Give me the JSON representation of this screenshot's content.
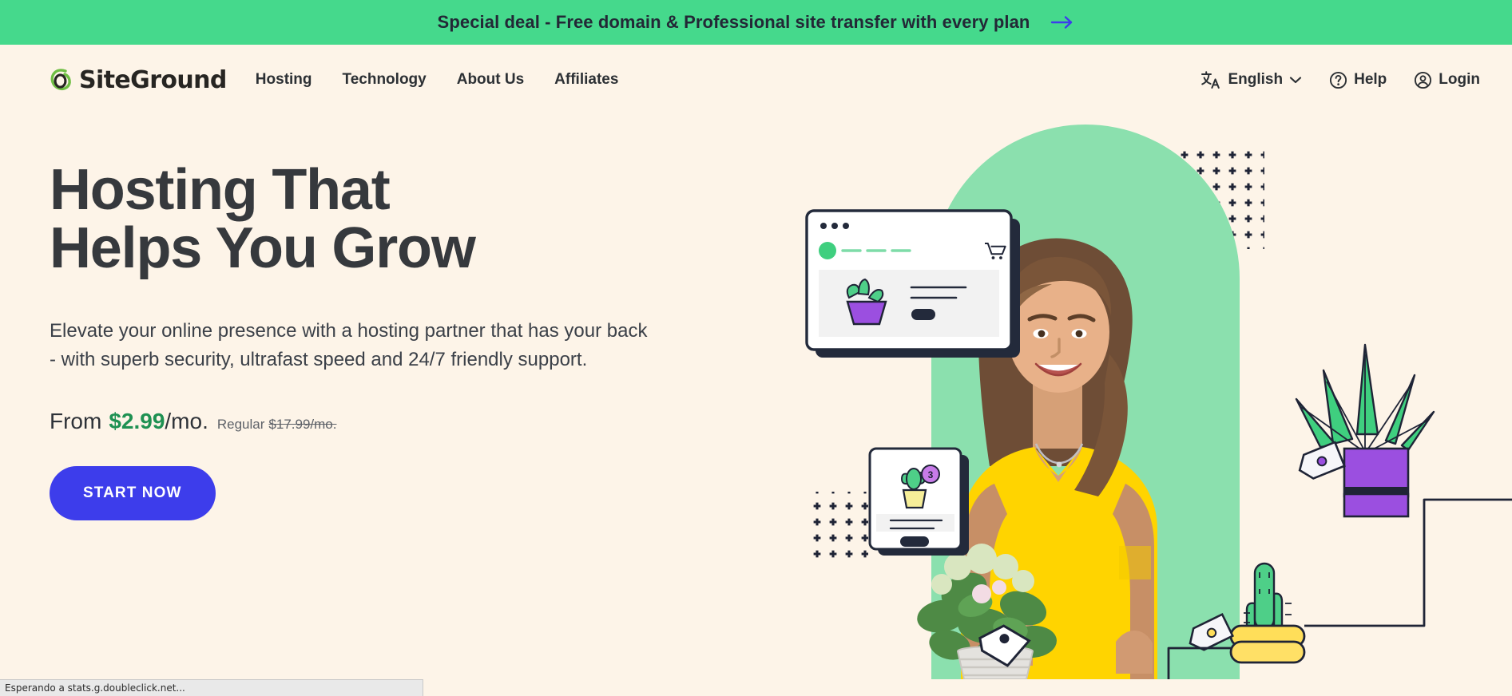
{
  "promo": {
    "text": "Special deal - Free domain & Professional site transfer with every plan",
    "arrow_icon": "arrow-right-icon",
    "bg_color": "#45D98C",
    "text_color": "#232836",
    "arrow_color": "#3D3DEB"
  },
  "header": {
    "brand": {
      "name": "SiteGround",
      "mark_icon": "siteground-swirl-logo-icon",
      "mark_color": "#6FBE44"
    },
    "nav": [
      {
        "label": "Hosting"
      },
      {
        "label": "Technology"
      },
      {
        "label": "About Us"
      },
      {
        "label": "Affiliates"
      }
    ],
    "right": {
      "language": {
        "label": "English",
        "icon": "translate-icon",
        "chevron": "chevron-down-icon"
      },
      "help": {
        "label": "Help",
        "icon": "question-circle-icon"
      },
      "login": {
        "label": "Login",
        "icon": "user-circle-icon"
      }
    }
  },
  "hero": {
    "title": "Hosting That\nHelps You Grow",
    "subtitle": "Elevate your online presence with a hosting partner that has your back\n- with superb security, ultrafast speed and 24/7 friendly support.",
    "price": {
      "from_label": "From",
      "amount": "$2.99",
      "per": "/mo.",
      "regular_label": "Regular",
      "regular_price": "$17.99/mo.",
      "amount_color": "#1E9152"
    },
    "cta": {
      "label": "START NOW",
      "bg_color": "#3D3DEB"
    },
    "illustration": {
      "description": "smiling-woman-holding-plant-with-ecommerce-ui-cards",
      "arch_color": "#8BE0AE",
      "browser_card": {
        "window_dots": 3,
        "logo_dot_color": "#3FCF7F",
        "cart_icon": "shopping-cart-icon",
        "product_pot_color": "#9B4FE0",
        "product_leaf_color": "#3FCF7F",
        "button_color": "#232A3B"
      },
      "product_card": {
        "badge_value": "3",
        "badge_color": "#C77BE8",
        "pot_color": "#F6EE99",
        "cactus_color": "#4ECF88",
        "button_color": "#232A3B"
      },
      "right_plant": {
        "pot_color": "#9B4FE0",
        "leaf_color": "#3FCF7F",
        "tag_icon": "price-tag-icon"
      },
      "cactus_stack": {
        "pot_color": "#F7DF55",
        "cactus_color": "#4ECF88",
        "tag_icon": "price-tag-icon"
      },
      "dot_pattern_color": "#1F2436"
    }
  },
  "browser": {
    "status_text": "Esperando a stats.g.doubleclick.net..."
  },
  "theme": {
    "page_bg": "#FDF4E8",
    "text_dark": "#36393D",
    "accent_green": "#45D98C",
    "accent_blue": "#3D3DEB"
  }
}
